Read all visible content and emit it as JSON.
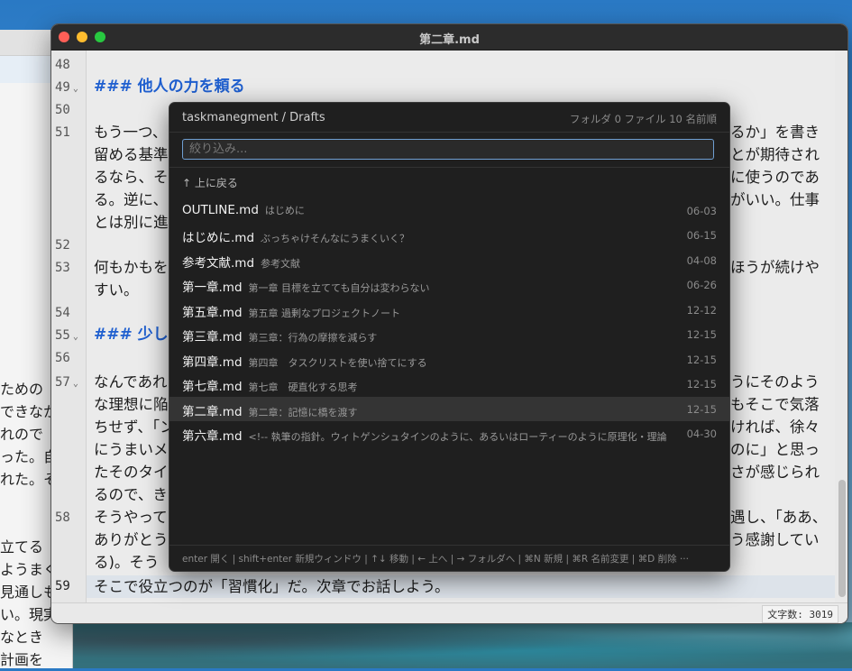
{
  "window": {
    "title": "第二章.md",
    "char_count": "文字数: 3019"
  },
  "background_window": {
    "lines": [
      "ための",
      "できなか",
      "れので",
      "った。自",
      "れた。そ",
      "",
      "立てる",
      "ようまく",
      "見通しも",
      "い。現実",
      "なとき",
      "計画を"
    ]
  },
  "editor": {
    "lines": [
      {
        "n": "48",
        "fold": false,
        "text": "",
        "heading": false
      },
      {
        "n": "49",
        "fold": true,
        "text": "### 他人の力を頼る",
        "heading": true
      },
      {
        "n": "50",
        "fold": false,
        "text": "",
        "heading": false
      },
      {
        "n": "51",
        "fold": false,
        "text": "もう一つ、",
        "heading": false,
        "cont": [
          "留める基準",
          "るなら、そ",
          "る。逆に、",
          "とは別に進"
        ],
        "right": [
          "るか」を書き",
          "とが期待され",
          "に使うのであ",
          "がいい。仕事",
          ""
        ]
      },
      {
        "n": "52",
        "fold": false,
        "text": "",
        "heading": false
      },
      {
        "n": "53",
        "fold": false,
        "text": "何もかもを",
        "heading": false,
        "cont": [
          "すい。"
        ],
        "right": [
          "ほうが続けや",
          ""
        ]
      },
      {
        "n": "54",
        "fold": false,
        "text": "",
        "heading": false
      },
      {
        "n": "55",
        "fold": true,
        "text": "### 少しず",
        "heading": true
      },
      {
        "n": "56",
        "fold": false,
        "text": "",
        "heading": false
      },
      {
        "n": "57",
        "fold": true,
        "text": "なんであれ",
        "heading": false,
        "cont": [
          "な理想に陥",
          "ちせず、「ン",
          "にうまいメ",
          "たそのタイ",
          "るので、き"
        ],
        "right": [
          "うにそのよう",
          "もそこで気落",
          "ければ、徐々",
          "のに」と思っ",
          "さが感じられ",
          ""
        ]
      },
      {
        "n": "58",
        "fold": false,
        "text": "そうやって",
        "heading": false,
        "cont": [
          "ありがとう",
          "る)。そう"
        ],
        "right": [
          "遇し、「ああ、",
          "う感謝してい",
          ""
        ]
      },
      {
        "n": "59",
        "fold": false,
        "text": "そこで役立つのが「習慣化」だ。次章でお話しよう。",
        "heading": false
      }
    ]
  },
  "palette": {
    "path": "taskmanegment / Drafts",
    "meta": "フォルダ 0  ファイル 10    名前順",
    "search_placeholder": "絞り込み...",
    "search_value": "",
    "up_label": "↑ 上に戻る",
    "files": [
      {
        "name": "OUTLINE.md",
        "desc": "はじめに",
        "date": "06-03",
        "selected": false
      },
      {
        "name": "はじめに.md",
        "desc": "ぶっちゃけそんなにうまくいく？",
        "date": "06-15",
        "selected": false
      },
      {
        "name": "参考文献.md",
        "desc": "参考文献",
        "date": "04-08",
        "selected": false
      },
      {
        "name": "第一章.md",
        "desc": "第一章 目標を立てても自分は変わらない",
        "date": "06-26",
        "selected": false
      },
      {
        "name": "第五章.md",
        "desc": "第五章 過剰なプロジェクトノート",
        "date": "12-12",
        "selected": false
      },
      {
        "name": "第三章.md",
        "desc": "第三章：行為の摩擦を減らす",
        "date": "12-15",
        "selected": false
      },
      {
        "name": "第四章.md",
        "desc": "第四章　タスクリストを使い捨てにする",
        "date": "12-15",
        "selected": false
      },
      {
        "name": "第七章.md",
        "desc": "第七章　硬直化する思考",
        "date": "12-15",
        "selected": false
      },
      {
        "name": "第二章.md",
        "desc": "第二章：記憶に橋を渡す",
        "date": "12-15",
        "selected": true
      },
      {
        "name": "第六章.md",
        "desc": "<!-- 執筆の指針。ウィトゲンシュタインのように、あるいはローティーのように原理化・理論…",
        "date": "04-30",
        "selected": false
      }
    ],
    "footer": "enter 開く  |  shift+enter 新規ウィンドウ  |  ↑↓ 移動  |  ← 上へ  |  → フォルダへ  |  ⌘N 新規  |  ⌘R 名前変更  |  ⌘D 削除  ···"
  }
}
